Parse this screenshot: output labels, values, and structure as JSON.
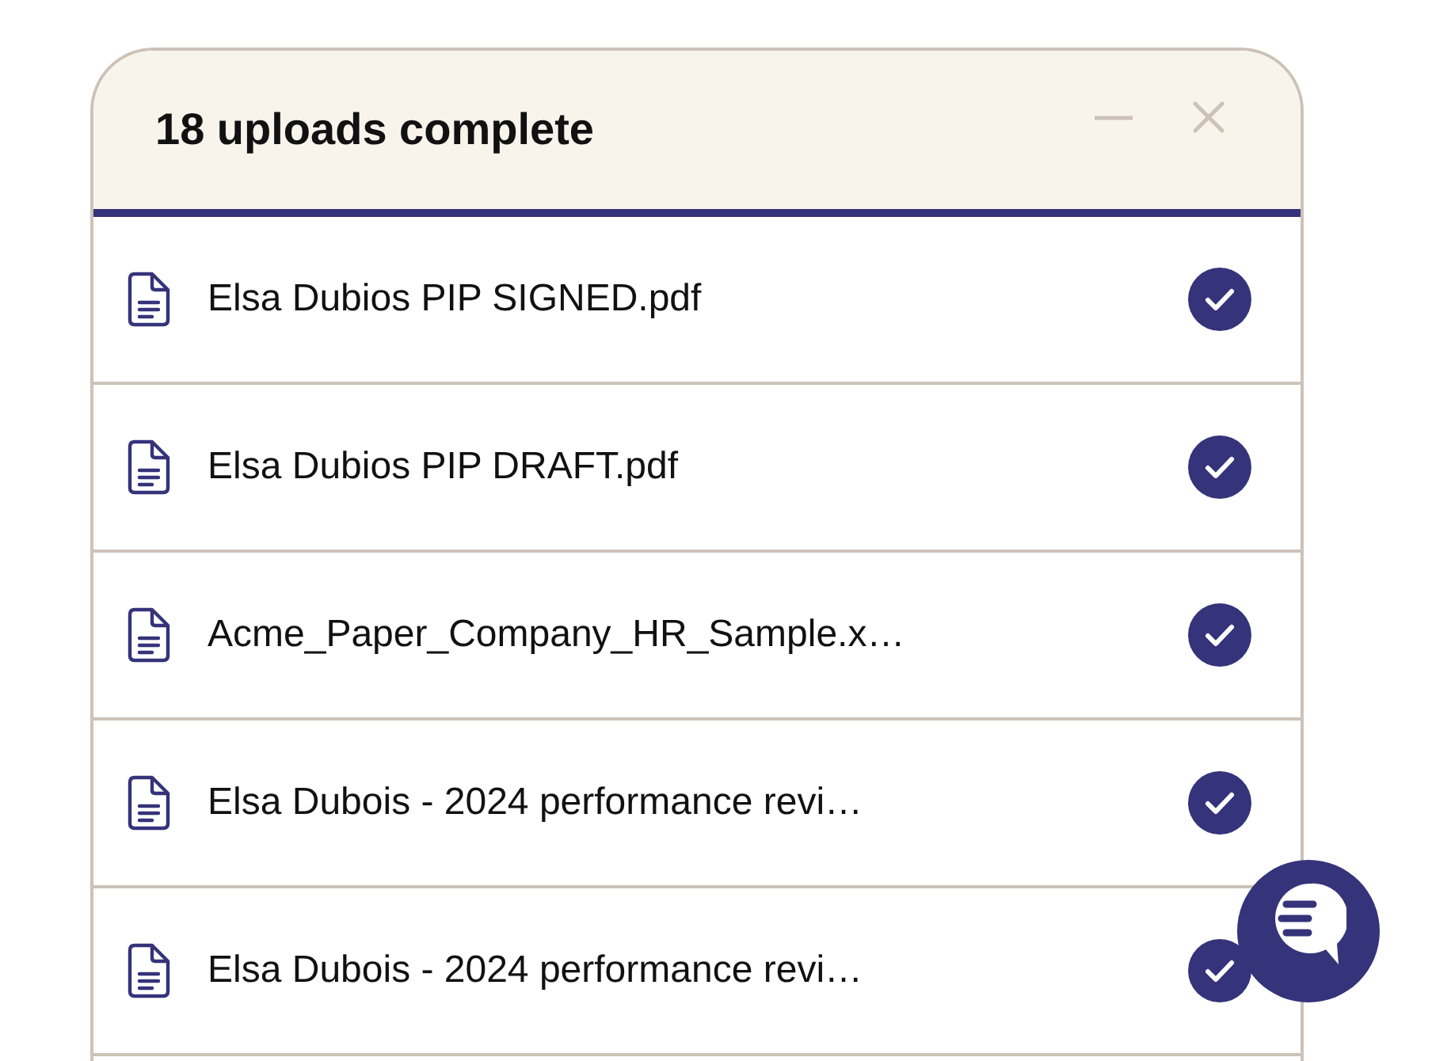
{
  "upload_panel": {
    "title": "18 uploads complete"
  },
  "files": [
    {
      "name": "Elsa Dubios PIP SIGNED.pdf",
      "complete": true
    },
    {
      "name": "Elsa Dubios PIP DRAFT.pdf",
      "complete": true
    },
    {
      "name": "Acme_Paper_Company_HR_Sample.x…",
      "complete": true
    },
    {
      "name": "Elsa Dubois - 2024 performance revi…",
      "complete": true
    },
    {
      "name": "Elsa Dubois - 2024 performance revi…",
      "complete": true
    }
  ]
}
